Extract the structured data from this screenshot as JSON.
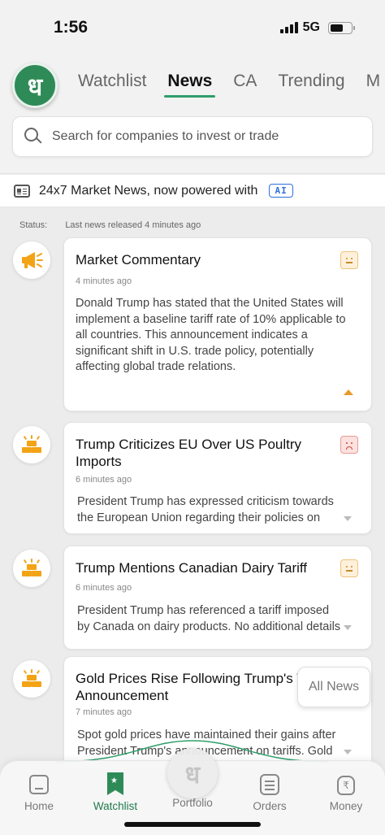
{
  "status_bar": {
    "time": "1:56",
    "network": "5G"
  },
  "header": {
    "logo_glyph": "ध",
    "tabs": [
      {
        "label": "Watchlist",
        "active": false
      },
      {
        "label": "News",
        "active": true
      },
      {
        "label": "CA",
        "active": false
      },
      {
        "label": "Trending",
        "active": false
      },
      {
        "label": "M",
        "active": false
      }
    ],
    "search": {
      "placeholder": "Search for companies to invest or trade"
    }
  },
  "banner": {
    "text": "24x7 Market News, now powered with",
    "badge": "AI"
  },
  "status_line": {
    "label": "Status:",
    "value": "Last news released 4 minutes ago"
  },
  "news": [
    {
      "icon": "megaphone-icon",
      "title": "Market Commentary",
      "time": "4 minutes ago",
      "body": "Donald Trump has stated that the United States will implement a baseline tariff rate of 10% applicable to all countries. This announcement indicates a significant shift in U.S. trade policy, potentially affecting global trade relations.",
      "sentiment": "neutral",
      "expanded": true
    },
    {
      "icon": "gold-bars-icon",
      "title": "Trump Criticizes EU Over US Poultry Imports",
      "time": "6 minutes ago",
      "body": "President Trump has expressed criticism towards the European Union regarding their policies on imports of US poultry.",
      "sentiment": "negative",
      "expanded": false
    },
    {
      "icon": "gold-bars-icon",
      "title": "Trump Mentions Canadian Dairy Tariff",
      "time": "6 minutes ago",
      "body": "President Trump has referenced a tariff imposed by Canada on dairy products. No additional details were provided.",
      "sentiment": "neutral",
      "expanded": false
    },
    {
      "icon": "gold-bars-icon",
      "title": "Gold Prices Rise Following Trump's Tariff Announcement",
      "time": "7 minutes ago",
      "body": "Spot gold prices have maintained their gains after President Trump's announcement on tariffs. Gold continues to rise.",
      "sentiment": "neutral",
      "expanded": false
    }
  ],
  "all_news_label": "All News",
  "bottom_nav": [
    {
      "label": "Home",
      "icon": "home-icon",
      "active": false
    },
    {
      "label": "Watchlist",
      "icon": "bookmark-icon",
      "active": true
    },
    {
      "label": "Portfolio",
      "icon": "logo-icon",
      "active": false
    },
    {
      "label": "Orders",
      "icon": "list-icon",
      "active": false
    },
    {
      "label": "Money",
      "icon": "money-bag-icon",
      "active": false
    }
  ],
  "colors": {
    "brand_green": "#2e8b57",
    "accent_orange": "#f2a316",
    "ai_blue": "#2f6fe0"
  }
}
